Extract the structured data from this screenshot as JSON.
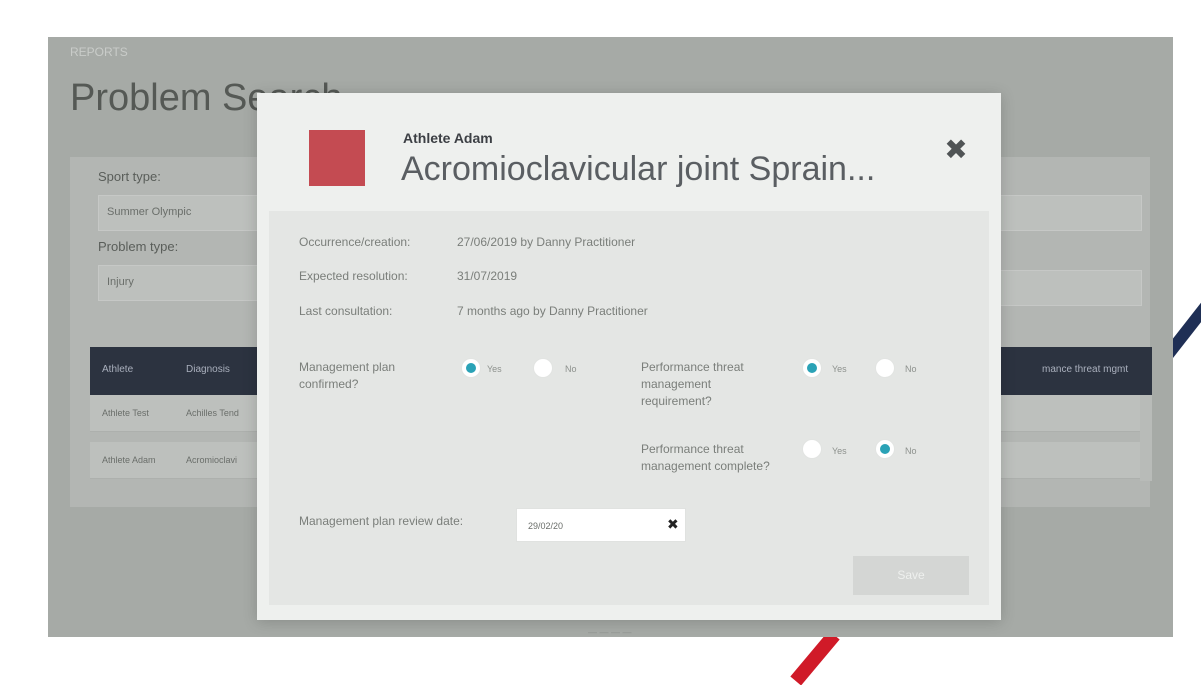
{
  "background": {
    "breadcrumb": "REPORTS",
    "page_title": "Problem Search",
    "filters": {
      "sport_type_label": "Sport type:",
      "sport_type_value": "Summer Olympic",
      "problem_type_label": "Problem type:",
      "problem_type_value": "Injury"
    },
    "table": {
      "columns": [
        "Athlete",
        "Diagnosis",
        "mance threat mgmt"
      ],
      "rows": [
        {
          "athlete": "Athlete Test",
          "diagnosis": "Achilles Tend"
        },
        {
          "athlete": "Athlete Adam",
          "diagnosis": "Acromioclavi"
        }
      ]
    },
    "pager_text": "— — — —"
  },
  "modal": {
    "athlete_name": "Athlete Adam",
    "problem_title": "Acromioclavicular joint Sprain...",
    "close_icon": "close-x-icon",
    "swatch_color": "#c44b52",
    "details": [
      {
        "label": "Occurrence/creation:",
        "value": "27/06/2019 by Danny Practitioner"
      },
      {
        "label": "Expected resolution:",
        "value": "31/07/2019"
      },
      {
        "label": "Last consultation:",
        "value": "7 months ago by Danny Practitioner"
      }
    ],
    "questions": {
      "plan_confirmed": {
        "label": "Management plan confirmed?",
        "yes": "Yes",
        "no": "No",
        "selected": "yes"
      },
      "threat_requirement": {
        "label": "Performance threat management requirement?",
        "yes": "Yes",
        "no": "No",
        "selected": "yes"
      },
      "threat_complete": {
        "label": "Performance threat management complete?",
        "yes": "Yes",
        "no": "No",
        "selected": "no"
      }
    },
    "review_date": {
      "label": "Management plan review date:",
      "value": "29/02/20",
      "clear_icon": "clear-x-icon"
    },
    "save_label": "Save",
    "accent_color": "#2aa2b6"
  }
}
